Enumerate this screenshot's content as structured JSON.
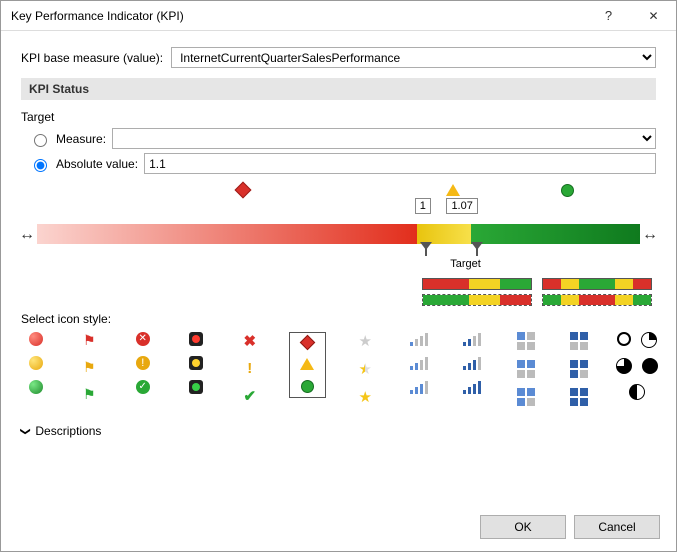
{
  "window": {
    "title": "Key Performance Indicator (KPI)",
    "help_icon": "?",
    "close_icon": "✕"
  },
  "base": {
    "label": "KPI base measure (value):",
    "value": "InternetCurrentQuarterSalesPerformance"
  },
  "status": {
    "header": "KPI Status",
    "target_label": "Target",
    "measure_label": "Measure:",
    "absolute_label": "Absolute value:",
    "absolute_value": "1.1",
    "handle1": "1",
    "handle2": "1.07",
    "target_axis_label": "Target"
  },
  "icons": {
    "section_label": "Select icon style:"
  },
  "descriptions": {
    "chevron": "❯",
    "label": "Descriptions"
  },
  "footer": {
    "ok": "OK",
    "cancel": "Cancel"
  }
}
